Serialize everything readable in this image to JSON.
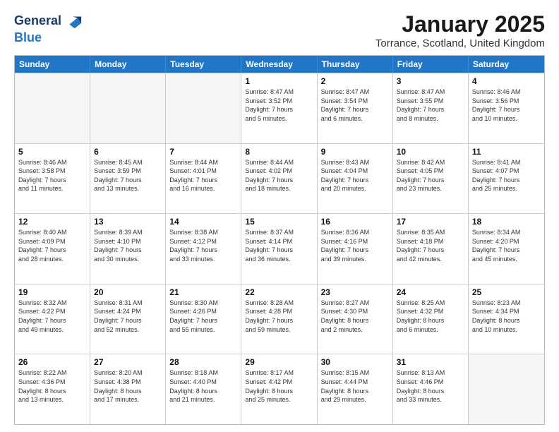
{
  "header": {
    "logo_line1": "General",
    "logo_line2": "Blue",
    "title": "January 2025",
    "subtitle": "Torrance, Scotland, United Kingdom"
  },
  "weekdays": [
    "Sunday",
    "Monday",
    "Tuesday",
    "Wednesday",
    "Thursday",
    "Friday",
    "Saturday"
  ],
  "rows": [
    [
      {
        "date": "",
        "info": ""
      },
      {
        "date": "",
        "info": ""
      },
      {
        "date": "",
        "info": ""
      },
      {
        "date": "1",
        "info": "Sunrise: 8:47 AM\nSunset: 3:52 PM\nDaylight: 7 hours\nand 5 minutes."
      },
      {
        "date": "2",
        "info": "Sunrise: 8:47 AM\nSunset: 3:54 PM\nDaylight: 7 hours\nand 6 minutes."
      },
      {
        "date": "3",
        "info": "Sunrise: 8:47 AM\nSunset: 3:55 PM\nDaylight: 7 hours\nand 8 minutes."
      },
      {
        "date": "4",
        "info": "Sunrise: 8:46 AM\nSunset: 3:56 PM\nDaylight: 7 hours\nand 10 minutes."
      }
    ],
    [
      {
        "date": "5",
        "info": "Sunrise: 8:46 AM\nSunset: 3:58 PM\nDaylight: 7 hours\nand 11 minutes."
      },
      {
        "date": "6",
        "info": "Sunrise: 8:45 AM\nSunset: 3:59 PM\nDaylight: 7 hours\nand 13 minutes."
      },
      {
        "date": "7",
        "info": "Sunrise: 8:44 AM\nSunset: 4:01 PM\nDaylight: 7 hours\nand 16 minutes."
      },
      {
        "date": "8",
        "info": "Sunrise: 8:44 AM\nSunset: 4:02 PM\nDaylight: 7 hours\nand 18 minutes."
      },
      {
        "date": "9",
        "info": "Sunrise: 8:43 AM\nSunset: 4:04 PM\nDaylight: 7 hours\nand 20 minutes."
      },
      {
        "date": "10",
        "info": "Sunrise: 8:42 AM\nSunset: 4:05 PM\nDaylight: 7 hours\nand 23 minutes."
      },
      {
        "date": "11",
        "info": "Sunrise: 8:41 AM\nSunset: 4:07 PM\nDaylight: 7 hours\nand 25 minutes."
      }
    ],
    [
      {
        "date": "12",
        "info": "Sunrise: 8:40 AM\nSunset: 4:09 PM\nDaylight: 7 hours\nand 28 minutes."
      },
      {
        "date": "13",
        "info": "Sunrise: 8:39 AM\nSunset: 4:10 PM\nDaylight: 7 hours\nand 30 minutes."
      },
      {
        "date": "14",
        "info": "Sunrise: 8:38 AM\nSunset: 4:12 PM\nDaylight: 7 hours\nand 33 minutes."
      },
      {
        "date": "15",
        "info": "Sunrise: 8:37 AM\nSunset: 4:14 PM\nDaylight: 7 hours\nand 36 minutes."
      },
      {
        "date": "16",
        "info": "Sunrise: 8:36 AM\nSunset: 4:16 PM\nDaylight: 7 hours\nand 39 minutes."
      },
      {
        "date": "17",
        "info": "Sunrise: 8:35 AM\nSunset: 4:18 PM\nDaylight: 7 hours\nand 42 minutes."
      },
      {
        "date": "18",
        "info": "Sunrise: 8:34 AM\nSunset: 4:20 PM\nDaylight: 7 hours\nand 45 minutes."
      }
    ],
    [
      {
        "date": "19",
        "info": "Sunrise: 8:32 AM\nSunset: 4:22 PM\nDaylight: 7 hours\nand 49 minutes."
      },
      {
        "date": "20",
        "info": "Sunrise: 8:31 AM\nSunset: 4:24 PM\nDaylight: 7 hours\nand 52 minutes."
      },
      {
        "date": "21",
        "info": "Sunrise: 8:30 AM\nSunset: 4:26 PM\nDaylight: 7 hours\nand 55 minutes."
      },
      {
        "date": "22",
        "info": "Sunrise: 8:28 AM\nSunset: 4:28 PM\nDaylight: 7 hours\nand 59 minutes."
      },
      {
        "date": "23",
        "info": "Sunrise: 8:27 AM\nSunset: 4:30 PM\nDaylight: 8 hours\nand 2 minutes."
      },
      {
        "date": "24",
        "info": "Sunrise: 8:25 AM\nSunset: 4:32 PM\nDaylight: 8 hours\nand 6 minutes."
      },
      {
        "date": "25",
        "info": "Sunrise: 8:23 AM\nSunset: 4:34 PM\nDaylight: 8 hours\nand 10 minutes."
      }
    ],
    [
      {
        "date": "26",
        "info": "Sunrise: 8:22 AM\nSunset: 4:36 PM\nDaylight: 8 hours\nand 13 minutes."
      },
      {
        "date": "27",
        "info": "Sunrise: 8:20 AM\nSunset: 4:38 PM\nDaylight: 8 hours\nand 17 minutes."
      },
      {
        "date": "28",
        "info": "Sunrise: 8:18 AM\nSunset: 4:40 PM\nDaylight: 8 hours\nand 21 minutes."
      },
      {
        "date": "29",
        "info": "Sunrise: 8:17 AM\nSunset: 4:42 PM\nDaylight: 8 hours\nand 25 minutes."
      },
      {
        "date": "30",
        "info": "Sunrise: 8:15 AM\nSunset: 4:44 PM\nDaylight: 8 hours\nand 29 minutes."
      },
      {
        "date": "31",
        "info": "Sunrise: 8:13 AM\nSunset: 4:46 PM\nDaylight: 8 hours\nand 33 minutes."
      },
      {
        "date": "",
        "info": ""
      }
    ]
  ]
}
